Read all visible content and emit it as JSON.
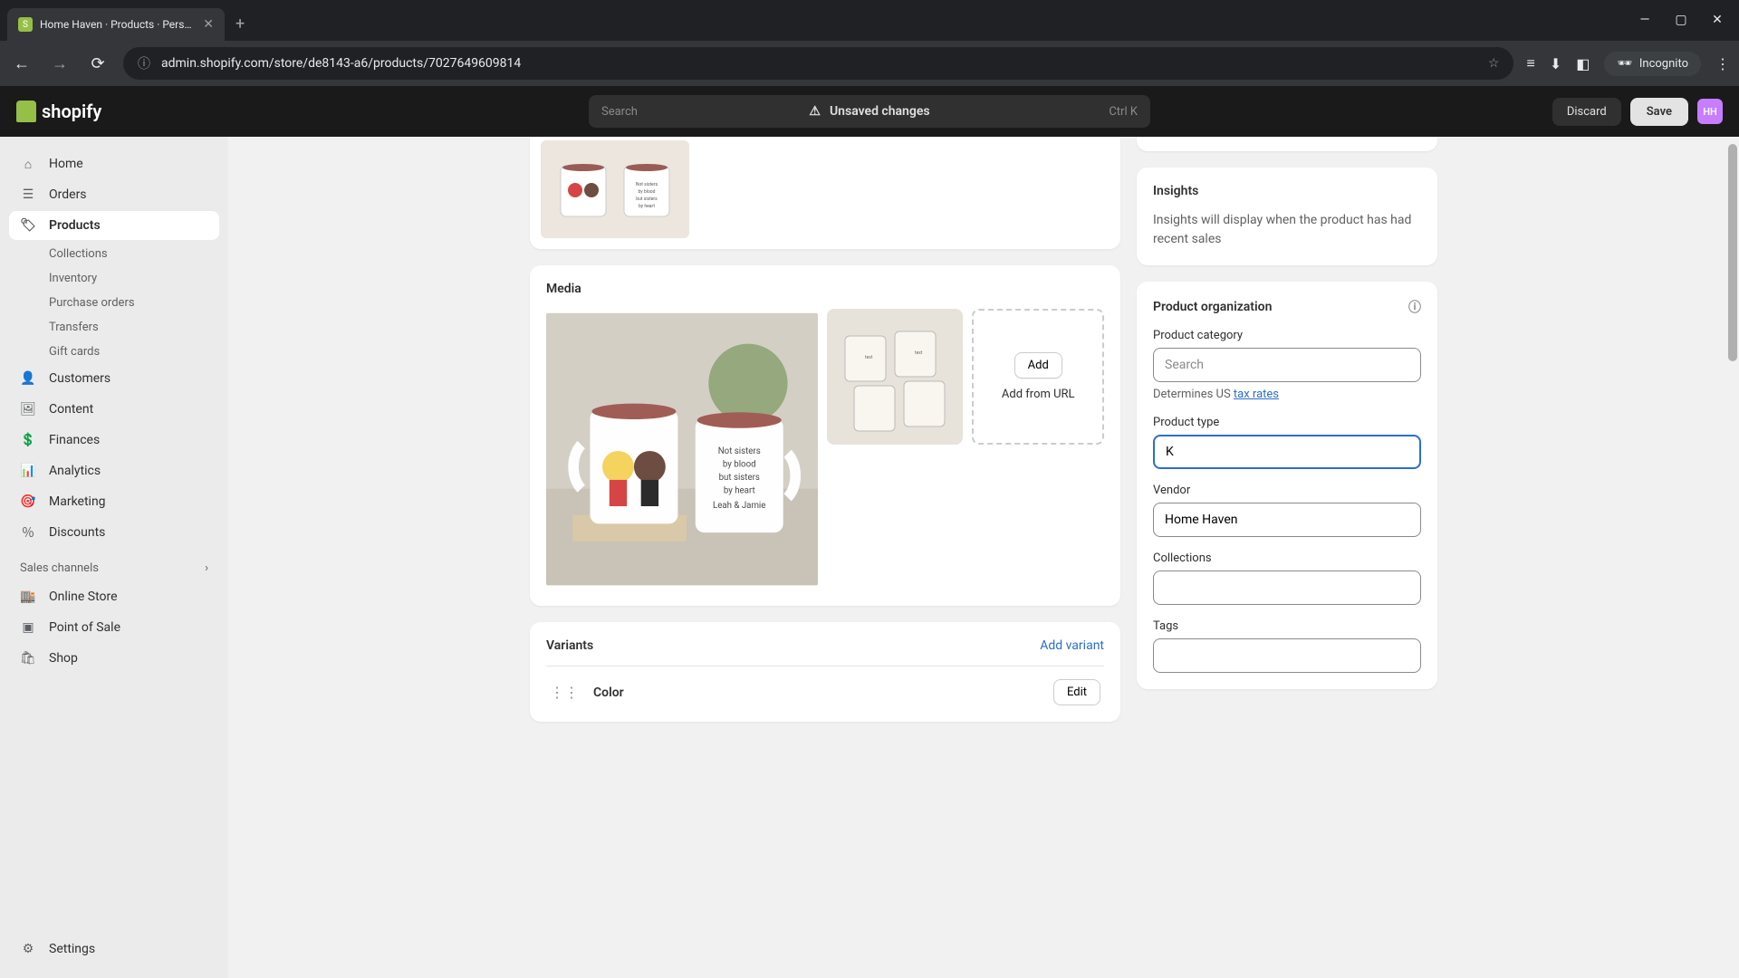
{
  "browser": {
    "tab_title": "Home Haven · Products · Perso…",
    "url": "admin.shopify.com/store/de8143-a6/products/7027649609814",
    "incognito": "Incognito"
  },
  "header": {
    "brand": "shopify",
    "search_placeholder": "Search",
    "search_kbd": "Ctrl K",
    "unsaved": "Unsaved changes",
    "discard": "Discard",
    "save": "Save",
    "store_initials": "HH"
  },
  "sidebar": {
    "home": "Home",
    "orders": "Orders",
    "products": "Products",
    "collections": "Collections",
    "inventory": "Inventory",
    "purchase_orders": "Purchase orders",
    "transfers": "Transfers",
    "gift_cards": "Gift cards",
    "customers": "Customers",
    "content": "Content",
    "finances": "Finances",
    "analytics": "Analytics",
    "marketing": "Marketing",
    "discounts": "Discounts",
    "sales_channels": "Sales channels",
    "online_store": "Online Store",
    "point_of_sale": "Point of Sale",
    "shop": "Shop",
    "settings": "Settings"
  },
  "media": {
    "title": "Media",
    "add": "Add",
    "add_url": "Add from URL"
  },
  "variants": {
    "title": "Variants",
    "add_variant": "Add variant",
    "option_name": "Color",
    "edit": "Edit"
  },
  "insights": {
    "title": "Insights",
    "text": "Insights will display when the product has had recent sales"
  },
  "organization": {
    "title": "Product organization",
    "category_label": "Product category",
    "category_placeholder": "Search",
    "helper_prefix": "Determines US ",
    "helper_link": "tax rates",
    "type_label": "Product type",
    "type_value": "K",
    "vendor_label": "Vendor",
    "vendor_value": "Home Haven",
    "collections_label": "Collections",
    "tags_label": "Tags"
  }
}
